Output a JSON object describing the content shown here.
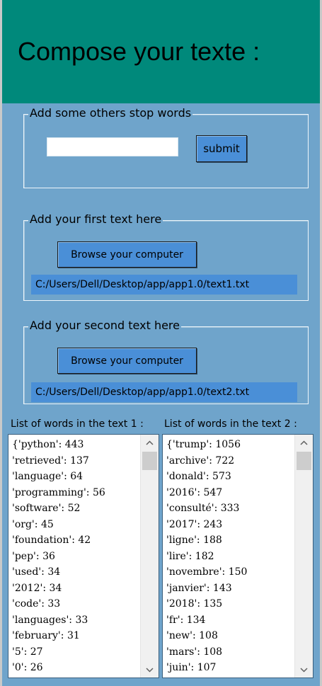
{
  "header": {
    "title": "Compose your texte :",
    "background": "#00897b"
  },
  "stop_words": {
    "label": "Add some others stop words",
    "input_value": "",
    "submit_label": "submit"
  },
  "first_text": {
    "label": "Add your first text here",
    "browse_label": "Browse your computer",
    "path": "C:/Users/Dell/Desktop/app/app1.0/text1.txt"
  },
  "second_text": {
    "label": "Add your second text here",
    "browse_label": "Browse your computer",
    "path": "C:/Users/Dell/Desktop/app/app1.0/text2.txt"
  },
  "list1": {
    "label": "List of words in the text 1 :",
    "items": [
      "{'python': 443",
      "'retrieved': 137",
      "'language': 64",
      "'programming': 56",
      "'software': 52",
      "'org': 45",
      "'foundation': 42",
      "'pep': 36",
      "'used': 34",
      "'2012': 34",
      "'code': 33",
      "'languages': 33",
      "'february': 31",
      "'5': 27",
      "'0': 26"
    ]
  },
  "list2": {
    "label": "List of words in the text 2 :",
    "items": [
      "{'trump': 1056",
      "'archive': 722",
      "'donald': 573",
      "'2016': 547",
      "'consulté': 333",
      "'2017': 243",
      "'ligne': 188",
      "'lire': 182",
      "'novembre': 150",
      "'janvier': 143",
      "'2018': 135",
      "'fr': 134",
      "'new': 108",
      "'mars': 108",
      "'juin': 107"
    ]
  },
  "icons": {
    "scroll_up": "chevron-up-icon",
    "scroll_down": "chevron-down-icon"
  },
  "colors": {
    "window_background": "#6fa4cb",
    "button_background": "#4a8fd7",
    "path_background": "#4a8fd7"
  }
}
